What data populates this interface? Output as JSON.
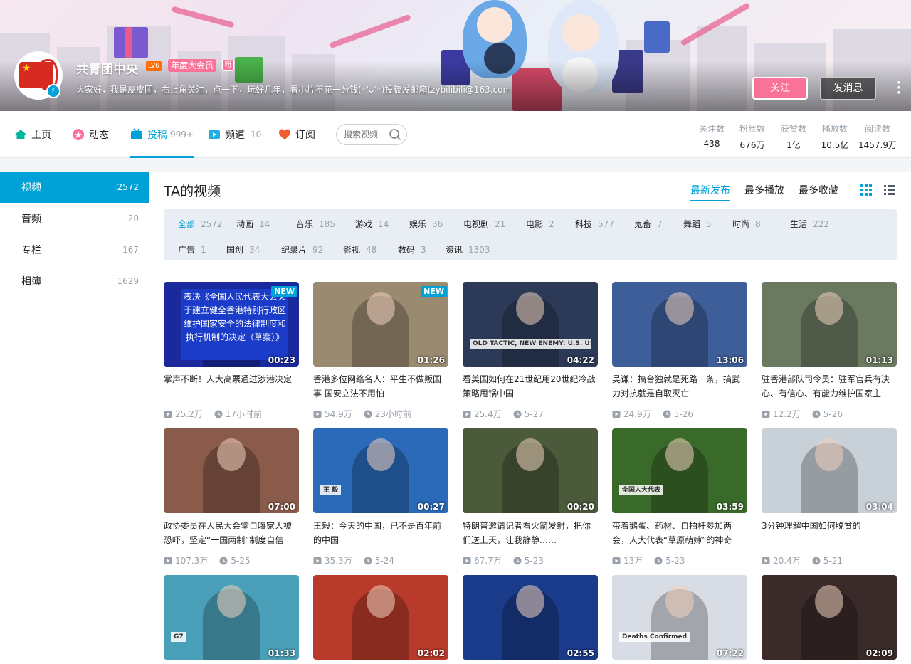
{
  "profile": {
    "name": "共青团中央",
    "level": "LV6",
    "vip_badge": "年度大会员",
    "fan_badge": "粉",
    "signature": "大家好，我是皮皮团，右上角关注，点一下，玩好几年，看小片不花一分钱(◦'ᴗ'◦)投稿发邮箱tzybilibili@163.com",
    "follow_label": "关注",
    "message_label": "发消息"
  },
  "nav": {
    "items": [
      {
        "label": "主页",
        "count": ""
      },
      {
        "label": "动态",
        "count": ""
      },
      {
        "label": "投稿",
        "count": "999+"
      },
      {
        "label": "频道",
        "count": "10"
      },
      {
        "label": "订阅",
        "count": ""
      }
    ],
    "search_placeholder": "搜索视频"
  },
  "stats": [
    {
      "label": "关注数",
      "value": "438"
    },
    {
      "label": "粉丝数",
      "value": "676万"
    },
    {
      "label": "获赞数",
      "value": "1亿"
    },
    {
      "label": "播放数",
      "value": "10.5亿"
    },
    {
      "label": "阅读数",
      "value": "1457.9万"
    }
  ],
  "sidebar": [
    {
      "label": "视频",
      "count": "2572"
    },
    {
      "label": "音频",
      "count": "20"
    },
    {
      "label": "专栏",
      "count": "167"
    },
    {
      "label": "相簿",
      "count": "1629"
    }
  ],
  "main": {
    "title": "TA的视频",
    "sort": [
      "最新发布",
      "最多播放",
      "最多收藏"
    ]
  },
  "filters": [
    {
      "label": "全部",
      "count": "2572"
    },
    {
      "label": "动画",
      "count": "14"
    },
    {
      "label": "音乐",
      "count": "185"
    },
    {
      "label": "游戏",
      "count": "14"
    },
    {
      "label": "娱乐",
      "count": "36"
    },
    {
      "label": "电视剧",
      "count": "21"
    },
    {
      "label": "电影",
      "count": "2"
    },
    {
      "label": "科技",
      "count": "577"
    },
    {
      "label": "鬼畜",
      "count": "7"
    },
    {
      "label": "舞蹈",
      "count": "5"
    },
    {
      "label": "时尚",
      "count": "8"
    },
    {
      "label": "生活",
      "count": "222"
    },
    {
      "label": "广告",
      "count": "1"
    },
    {
      "label": "国创",
      "count": "34"
    },
    {
      "label": "纪录片",
      "count": "92"
    },
    {
      "label": "影视",
      "count": "48"
    },
    {
      "label": "数码",
      "count": "3"
    },
    {
      "label": "资讯",
      "count": "1303"
    }
  ],
  "videos": [
    {
      "title": "掌声不断！人大高票通过涉港决定",
      "plays": "25.2万",
      "time": "17小时前",
      "duration": "00:23",
      "new": "NEW",
      "thumb_text": "表决《全国人民代表大会关于建立健全香港特别行政区维护国家安全的法律制度和执行机制的决定（草案）》",
      "bg": "#1a2a9c"
    },
    {
      "title": "香港多位网络名人：平生不做叛国事 国安立法不用怕",
      "plays": "54.9万",
      "time": "23小时前",
      "duration": "01:26",
      "new": "NEW",
      "thumb_text": "",
      "bg": "#9a8a70"
    },
    {
      "title": "看美国如何在21世纪用20世纪冷战策略甩锅中国",
      "plays": "25.4万",
      "time": "5-27",
      "duration": "04:22",
      "new": "",
      "thumb_text": "OLD TACTIC, NEW ENEMY: U.S. USING COLD-WAR METHODS AGAINST CHINA",
      "bg": "#2c3a58"
    },
    {
      "title": "吴谦：搞台独就是死路一条，搞武力对抗就是自取灭亡",
      "plays": "24.9万",
      "time": "5-26",
      "duration": "13:06",
      "new": "",
      "thumb_text": "",
      "bg": "#3e5e9a"
    },
    {
      "title": "驻香港部队司令员：驻军官兵有决心、有信心、有能力维护国家主",
      "plays": "12.2万",
      "time": "5-26",
      "duration": "01:13",
      "new": "",
      "thumb_text": "",
      "bg": "#6a7a60"
    },
    {
      "title": "政协委员在人民大会堂自曝家人被恐吓，坚定“一国两制”制度自信",
      "plays": "107.3万",
      "time": "5-25",
      "duration": "07:00",
      "new": "",
      "thumb_text": "",
      "bg": "#8a5a4a"
    },
    {
      "title": "王毅：今天的中国，已不是百年前的中国",
      "plays": "35.3万",
      "time": "5-24",
      "duration": "00:27",
      "new": "",
      "thumb_text": "王 毅",
      "bg": "#2a6ab8"
    },
    {
      "title": "特朗普邀请记者看火箭发射，把你们送上天，让我静静……",
      "plays": "67.7万",
      "time": "5-23",
      "duration": "00:20",
      "new": "",
      "thumb_text": "",
      "bg": "#4a5a3a"
    },
    {
      "title": "带着鹅蛋、药材、自拍杆参加两会，人大代表“草原萌婶”的神奇",
      "plays": "13万",
      "time": "5-23",
      "duration": "03:59",
      "new": "",
      "thumb_text": "全国人大代表",
      "bg": "#3a6a2a"
    },
    {
      "title": "3分钟理解中国如何脱贫的",
      "plays": "20.4万",
      "time": "5-21",
      "duration": "03:04",
      "new": "",
      "thumb_text": "",
      "bg": "#c8d0d8"
    },
    {
      "title": "",
      "plays": "",
      "time": "",
      "duration": "01:33",
      "new": "",
      "thumb_text": "G7",
      "bg": "#4aa0b8"
    },
    {
      "title": "",
      "plays": "",
      "time": "",
      "duration": "02:02",
      "new": "",
      "thumb_text": "",
      "bg": "#b83a2a"
    },
    {
      "title": "",
      "plays": "",
      "time": "",
      "duration": "02:55",
      "new": "",
      "thumb_text": "",
      "bg": "#1a3a8a"
    },
    {
      "title": "",
      "plays": "",
      "time": "",
      "duration": "07:22",
      "new": "",
      "thumb_text": "Deaths Confirmed",
      "bg": "#d8dce4"
    },
    {
      "title": "",
      "plays": "",
      "time": "",
      "duration": "02:09",
      "new": "",
      "thumb_text": "",
      "bg": "#3a2a2a"
    }
  ],
  "colors": {
    "accent": "#00a1d6",
    "pink": "#fb7299",
    "muted": "#99a2aa"
  }
}
